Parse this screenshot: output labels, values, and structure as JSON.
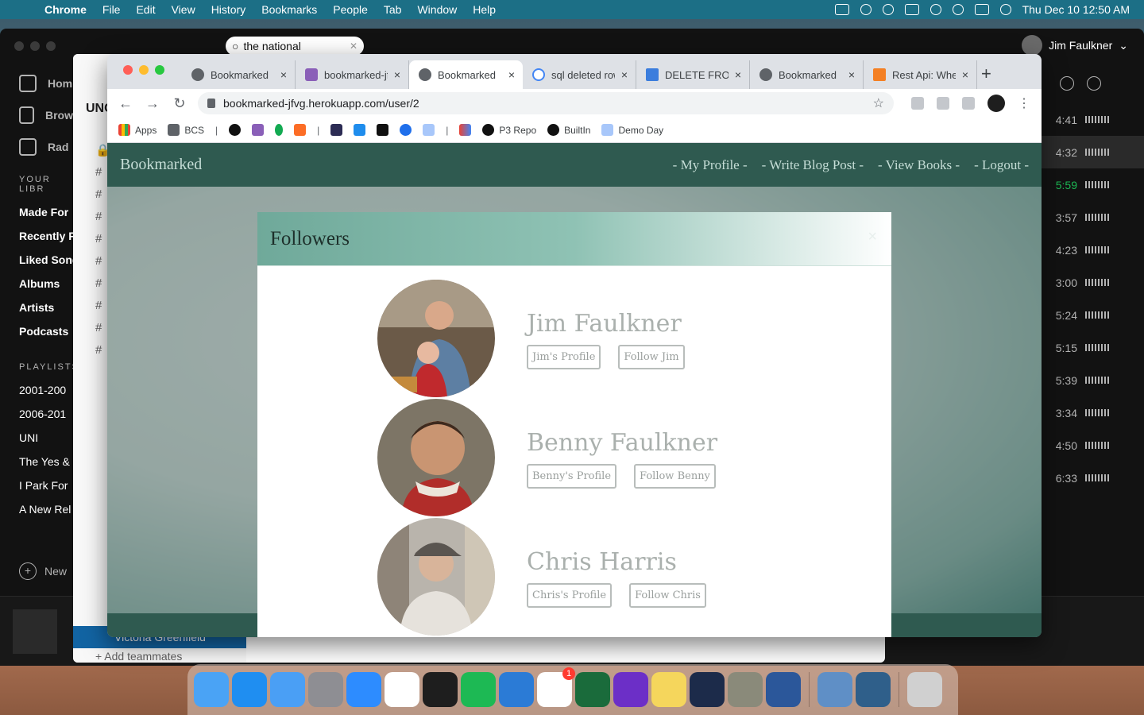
{
  "menubar": {
    "app": "Chrome",
    "items": [
      "File",
      "Edit",
      "View",
      "History",
      "Bookmarks",
      "People",
      "Tab",
      "Window",
      "Help"
    ],
    "datetime": "Thu Dec 10  12:50 AM"
  },
  "spotify": {
    "search_value": "the national",
    "user_name": "Jim Faulkner",
    "nav": [
      "Hom",
      "Brow",
      "Rad"
    ],
    "library_header": "YOUR LIBR",
    "library": [
      "Made For",
      "Recently P",
      "Liked Song",
      "Albums",
      "Artists",
      "Podcasts"
    ],
    "playlists_header": "PLAYLISTS",
    "playlists": [
      "2001-200",
      "2006-201",
      "UNI",
      "The Yes &",
      "I Park For",
      "A New Rel"
    ],
    "new_label": "New",
    "durations": [
      "4:41",
      "4:32",
      "5:59",
      "3:57",
      "4:23",
      "3:00",
      "5:24",
      "5:15",
      "5:39",
      "3:34",
      "4:50",
      "6:33"
    ],
    "playing_index": 2
  },
  "slack": {
    "workspace": "UNC",
    "selected_member": "Victoria Greenfield",
    "add_teammates": "Add teammates"
  },
  "chrome": {
    "tabs": [
      {
        "title": "Bookmarked",
        "icon": "globe-icon"
      },
      {
        "title": "bookmarked-jfvg",
        "icon": "heroku-icon"
      },
      {
        "title": "Bookmarked",
        "icon": "globe-icon",
        "active": true
      },
      {
        "title": "sql deleted row",
        "icon": "google-icon"
      },
      {
        "title": "DELETE FROM",
        "icon": "azure-icon"
      },
      {
        "title": "Bookmarked",
        "icon": "globe-icon"
      },
      {
        "title": "Rest Api: When",
        "icon": "stackoverflow-icon"
      }
    ],
    "url": "bookmarked-jfvg.herokuapp.com/user/2",
    "bookmarks": [
      "Apps",
      "BCS",
      "P3 Repo",
      "BuiltIn",
      "Demo Day"
    ]
  },
  "site": {
    "brand": "Bookmarked",
    "nav_links": [
      "- My Profile -",
      "- Write Blog Post -",
      "- View Books -",
      "- Logout -"
    ]
  },
  "modal": {
    "title": "Followers",
    "close": "×",
    "followers": [
      {
        "name": "Jim Faulkner",
        "profile_btn": "Jim's Profile",
        "follow_btn": "Follow Jim"
      },
      {
        "name": "Benny Faulkner",
        "profile_btn": "Benny's Profile",
        "follow_btn": "Follow Benny"
      },
      {
        "name": "Chris Harris",
        "profile_btn": "Chris's Profile",
        "follow_btn": "Follow Chris"
      }
    ]
  },
  "dock": {
    "apps": [
      "Finder",
      "App Store",
      "Mail",
      "System Preferences",
      "Zoom",
      "Chrome",
      "Terminal",
      "Spotify",
      "VS Code",
      "Slack",
      "GitKraken",
      "Tor",
      "Notes",
      "Lightroom",
      "GIMP",
      "Word",
      "Preview",
      "MySQL Workbench",
      "Trash"
    ],
    "slack_badge": "1"
  },
  "colors": {
    "menubar": "#1c6f86",
    "site_nav": "#2f5a50",
    "modal_header_start": "#6fa99a",
    "spotify_green": "#1db954"
  }
}
